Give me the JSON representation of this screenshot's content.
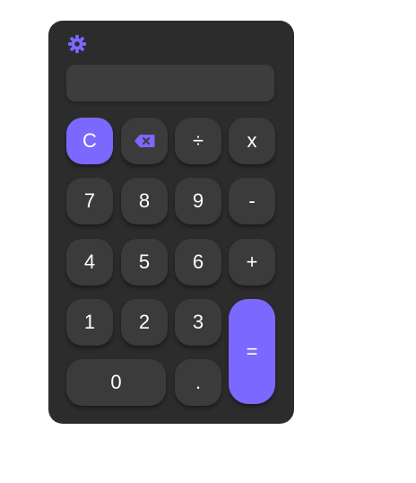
{
  "colors": {
    "accent": "#7b68ff",
    "body": "#2c2c2c",
    "key": "#3b3b3b",
    "display": "#3d3d3d"
  },
  "settings": {
    "icon": "gear-icon"
  },
  "display": {
    "value": ""
  },
  "keys": {
    "clear": "C",
    "backspace_icon": "backspace-icon",
    "divide": "÷",
    "multiply": "x",
    "seven": "7",
    "eight": "8",
    "nine": "9",
    "minus": "-",
    "four": "4",
    "five": "5",
    "six": "6",
    "plus": "+",
    "one": "1",
    "two": "2",
    "three": "3",
    "equals": "=",
    "zero": "0",
    "decimal": "."
  }
}
